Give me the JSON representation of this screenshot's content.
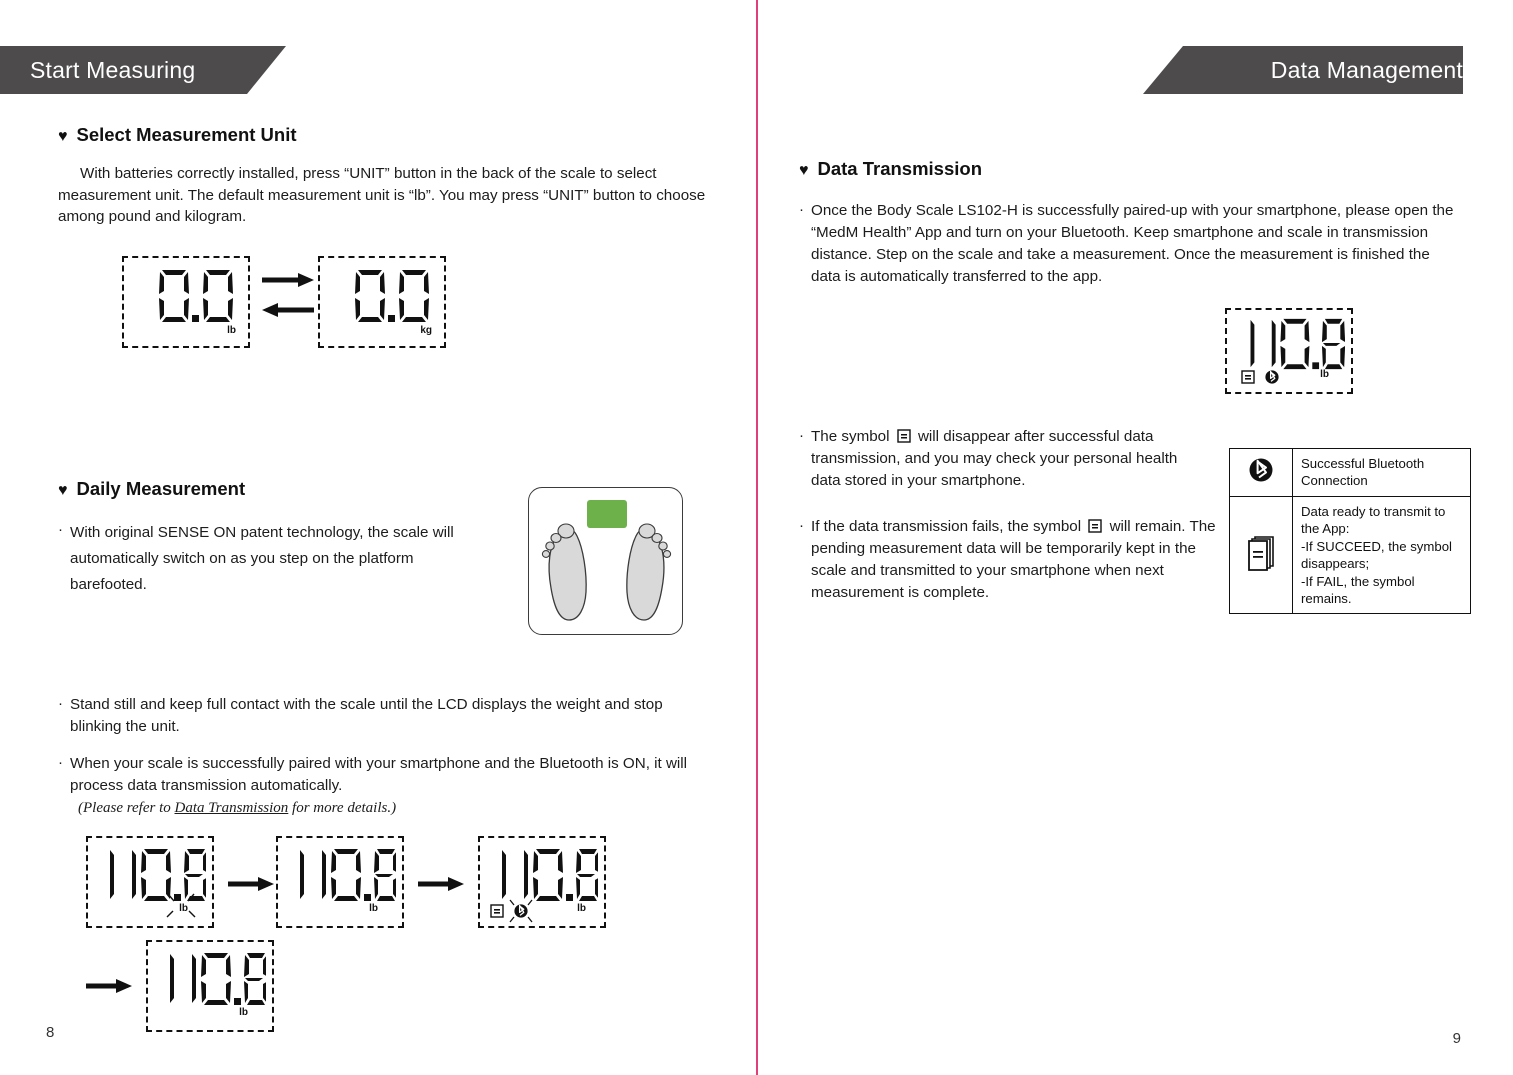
{
  "left_page": {
    "banner": "Start Measuring",
    "page_number": "8",
    "section1": {
      "heading": "Select Measurement Unit",
      "paragraph": "With batteries correctly installed, press “UNIT” button in the back of the scale to select measurement unit. The default measurement unit is “lb”. You may press “UNIT” button to choose among pound and kilogram.",
      "lcd_lb": {
        "value": "0.0",
        "unit": "lb"
      },
      "lcd_kg": {
        "value": "0.0",
        "unit": "kg"
      },
      "arrow_right": "arrow-right-icon",
      "arrow_left": "arrow-left-icon"
    },
    "section2": {
      "heading": "Daily Measurement",
      "bullets": [
        "With original SENSE ON patent technology, the scale will automatically switch on as you step on the platform barefooted.",
        "Stand still and keep full contact with the scale until the LCD displays the weight and stop blinking the unit.",
        "When your scale is successfully paired with your smartphone and the Bluetooth is ON, it will process data transmission automatically."
      ],
      "note_prefix": "(Please refer to ",
      "note_link": "Data Transmission",
      "note_suffix": " for more details.)",
      "scale_illustration": {
        "name": "body-scale-illustration",
        "display_color": "#6cb14a",
        "foot_color": "#d9d9d9"
      },
      "sequence": [
        {
          "value": "110.8",
          "unit": "lb",
          "blinking_unit": true,
          "icons": []
        },
        {
          "value": "110.8",
          "unit": "lb",
          "blinking_unit": false,
          "icons": []
        },
        {
          "value": "110.8",
          "unit": "lb",
          "blinking_unit": false,
          "icons": [
            "document-icon",
            "bluetooth-icon"
          ]
        },
        {
          "value": "110.8",
          "unit": "lb",
          "blinking_unit": false,
          "icons": []
        }
      ]
    }
  },
  "right_page": {
    "banner": "Data Management",
    "page_number": "9",
    "section1": {
      "heading": "Data Transmission",
      "bullet1": "Once the Body Scale LS102-H is successfully paired-up with your smartphone, please open the “MedM Health” App and turn on your Bluetooth. Keep smartphone and scale in transmission distance. Step on the scale and take a measurement. Once the measurement is finished the data is automatically transferred to the app.",
      "lcd": {
        "value": "110.8",
        "unit": "lb",
        "icons": [
          "document-icon",
          "bluetooth-icon"
        ]
      },
      "bullet2_part1": "The symbol ",
      "bullet2_part2": " will disappear after successful data transmission, and you may check your personal health data stored in your smartphone.",
      "bullet3_part1": "If the data transmission fails, the symbol ",
      "bullet3_part2": " will remain. The pending measurement data will be temporarily kept in the scale and transmitted to your smartphone when next measurement is complete."
    },
    "legend": {
      "rows": [
        {
          "icon": "bluetooth-icon",
          "text": "Successful Bluetooth Connection"
        },
        {
          "icon": "document-icon",
          "text": "Data ready to transmit to the App:\n-If SUCCEED, the symbol disappears;\n-If FAIL, the symbol remains."
        }
      ]
    }
  },
  "colors": {
    "banner_bg": "#4d4b4c",
    "divider": "#e0407a",
    "lcd_display_green": "#6cb14a",
    "foot_gray": "#d9d9d9"
  }
}
